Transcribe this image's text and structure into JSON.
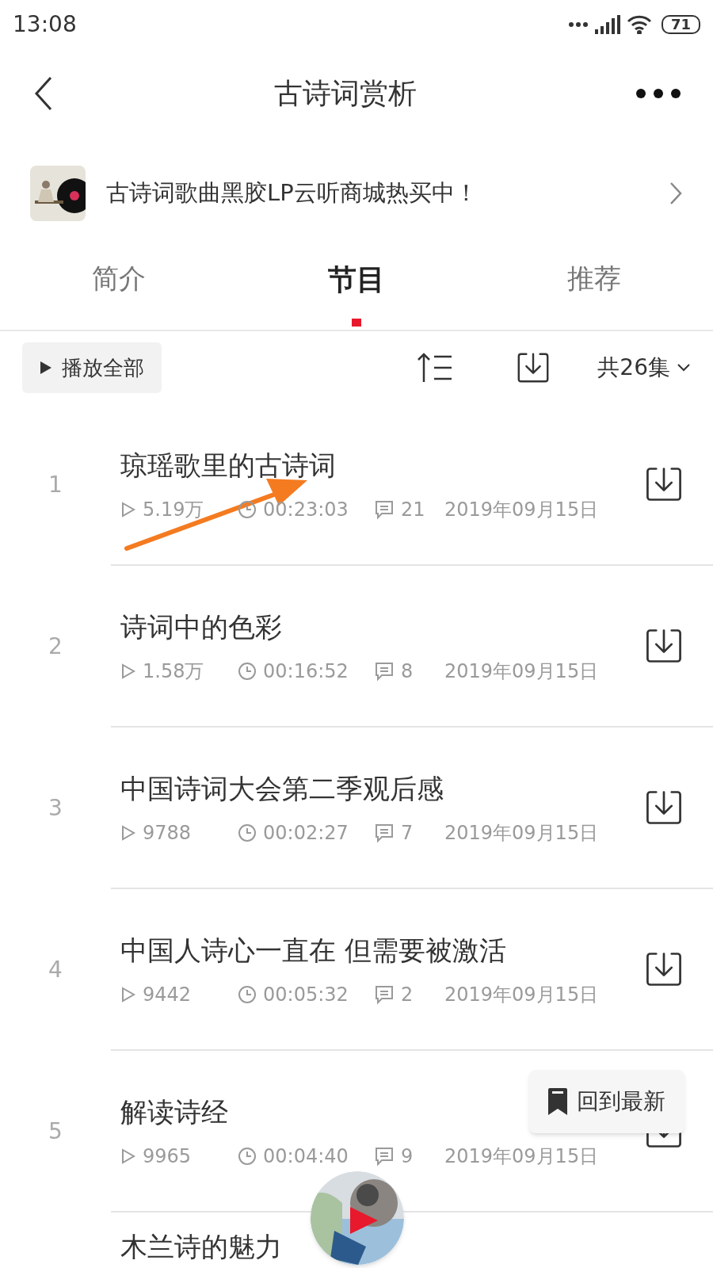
{
  "status_bar": {
    "time": "13:08",
    "battery": "71"
  },
  "header": {
    "title": "古诗词赏析"
  },
  "banner": {
    "text": "古诗词歌曲黑胶LP云听商城热买中！"
  },
  "tabs": [
    {
      "label": "简介",
      "selected": false
    },
    {
      "label": "节目",
      "selected": true
    },
    {
      "label": "推荐",
      "selected": false
    }
  ],
  "toolbar": {
    "play_all": "播放全部",
    "count": "共26集"
  },
  "episodes": [
    {
      "index": "1",
      "title": "琼瑶歌里的古诗词",
      "plays": "5.19万",
      "duration": "00:23:03",
      "comments": "21",
      "date": "2019年09月15日"
    },
    {
      "index": "2",
      "title": "诗词中的色彩",
      "plays": "1.58万",
      "duration": "00:16:52",
      "comments": "8",
      "date": "2019年09月15日"
    },
    {
      "index": "3",
      "title": "中国诗词大会第二季观后感",
      "plays": "9788",
      "duration": "00:02:27",
      "comments": "7",
      "date": "2019年09月15日"
    },
    {
      "index": "4",
      "title": "中国人诗心一直在 但需要被激活",
      "plays": "9442",
      "duration": "00:05:32",
      "comments": "2",
      "date": "2019年09月15日"
    },
    {
      "index": "5",
      "title": "解读诗经",
      "plays": "9965",
      "duration": "00:04:40",
      "comments": "9",
      "date": "2019年09月15日"
    },
    {
      "title": "木兰诗的魅力"
    }
  ],
  "back_to_latest": {
    "label": "回到最新"
  }
}
